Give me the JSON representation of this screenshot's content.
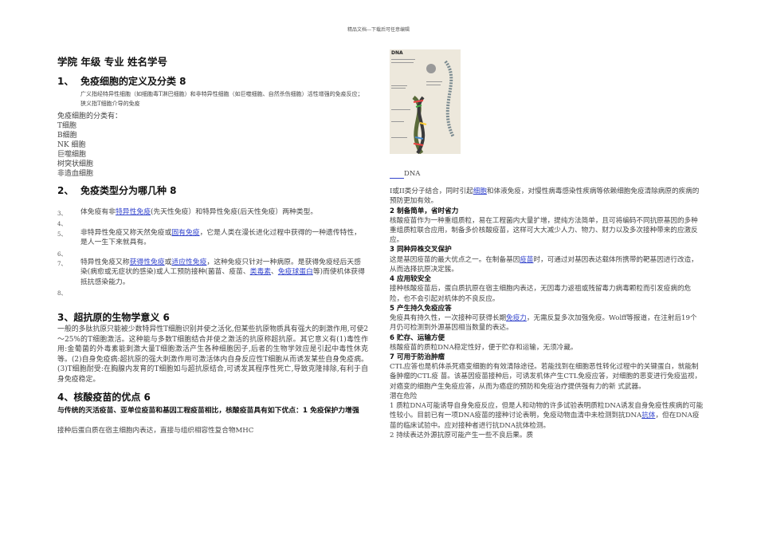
{
  "header": "精品文档---下载后可任意编辑",
  "title": "学院 年级 专业 姓名学号",
  "s1": {
    "num": "1、",
    "title": "免疫细胞的定义及分类 8",
    "def": "广义指经特异性细胞（如细胞毒T淋巴细胞）和非特异性细胞（如巨噬细胞、自然杀伤细胞）活性增强的免疫反应；狭义指T细胞介导的免疫",
    "cls_label": "免疫细胞的分类有：",
    "cells": [
      "T细胞",
      "B细胞",
      "NK 细胞",
      "巨噬细胞",
      "树突状细胞",
      "非造血细胞"
    ]
  },
  "s2": {
    "num": "2、",
    "title": "免疫类型分为哪几种 8",
    "items": [
      {
        "n": "3、",
        "a": "体免疫有非",
        "l1": "特异性免疫",
        "b": "(先天性免疫）和特异性免疫(后天性免疫）两种类型。"
      },
      {
        "n": "4、"
      },
      {
        "n": "5、",
        "a": "非特异性免疫又称天然免疫或",
        "l1": "固有免疫",
        "b": "，它是人类在漫长进化过程中获得的一种遗传特性，是人一生下来就具有。"
      },
      {
        "n": "6、"
      },
      {
        "n": "7、",
        "a": "特异性免疫又称",
        "l1": "获得性免疫",
        "m": "或",
        "l2": "适应性免疫",
        "b": "，这种免疫只针对一种病原。是获得免疫经后天感染(病愈或无症状的感染)或人工预防接种(菌苗、疫苗、",
        "l3": "类毒素",
        "c": "、",
        "l4": "免疫球蛋白",
        "d": "等)而使机体获得抵抗感染能力。"
      },
      {
        "n": "8、"
      }
    ]
  },
  "s3": {
    "title": "3、超抗原的生物学意义 6",
    "text": "一般的多肽抗原只能被少数特异性T细胞识别并使之活化,但某些抗原物质具有强大的刺激作用,可使2～25%的T细胞激活。这种能与多数T细胞结合并使之激活的抗原称超抗原。其它意义有(1)毒性作用:金葡菌的外毒素能刺激大量T细胞激活产生各种细胞因子,后者的生物学效应是引起中毒性休克等。(2)自身免疫病:超抗原的强大刺激作用可激活体内自身反应性T细胞从而诱发某些自身免疫病。(3)T细胞耐受:在胸腺内发育的T细胞如与超抗原结合,可诱发其程序性死亡,导致克隆排除,有利于自身免疫稳定。"
  },
  "s4": {
    "title": "4、核酸疫苗的优点 6",
    "intro": "与传统的灭活疫苗、亚单位疫苗和基因工程疫苗相比，核酸疫苗具有如下优点：1 免疫保护力增强",
    "p1": "接种后蛋白质在宿主细胞内表达，直接与组织相容性复合物MHC"
  },
  "right": {
    "img_label": "DNA",
    "caption": "DNA",
    "p1a": "I或II类分子结合，同时引起",
    "p1l": "细胞",
    "p1b": "和体液免疫，对慢性病毒感染性疾病等依赖细胞免疫清除病原的疾病的预防更加有效。",
    "h2": "2 制备简单，省时省力",
    "p2": "核酸疫苗作为一种重组质粒，易在工程菌内大量扩增，提纯方法简单，且可将编码不同抗原基因的多种重组质粒联合应用，制备多价核酸疫苗，这样可大大减少人力、物力、财力以及多次接种带来的应激反应。",
    "h3": "3 同种异株交叉保护",
    "p3a": "这是基因疫苗的最大优点之一。在制备基因",
    "p3l": "疫苗",
    "p3b": "时，可通过对基因表达载体所携带的靶基因进行改造，从而选择抗原决定簇。",
    "h4": "4 应用较安全",
    "p4": "接种核酸疫苗后，蛋白质抗原在宿主细胞内表达，无因毒力返祖或残留毒力病毒颗粒而引发疫病的危险，也不会引起对机体的不良反应。",
    "h5": "5 产生持久免疫应答",
    "p5a": "免疫具有持久性，一次接种可获得长期",
    "p5l": "免疫力",
    "p5b": "，无需反复多次加强免疫。Wolff等报道，在注射后19个月仍可检测到外源基因相当数量的表达。",
    "h6": "6 贮存、运输方便",
    "p6": "核酸疫苗的质粒DNA稳定性好，便于贮存和运输，无须冷藏。",
    "h7": "7 可用于防治肿瘤",
    "p7": "CTL应答也是机体杀死癌变细胞的有效清除途径。若能找到在细胞恶性转化过程中的关键蛋白，就能制备肿瘤的CTL疫 苗。该基因疫苗接种后，可诱发机体产生CTL免疫应答，对细胞的恶变进行免疫监视，对癌变的细胞产生免疫应答，从而为癌症的预防和免疫治疗提供强有力的新 式武器。",
    "risk": "潜在危险",
    "r1a": "1 质粒DNA可能诱导自身免疫反应，但是人和动物的许多试验表明质粒DNA诱发自身免疫性疾病的可能性较小。目前已有一项DNA疫苗的接种讨论表明，免疫动物血清中未检测到抗DNA",
    "r1l": "抗体",
    "r1b": "，但在DNA疫苗的临床试验中。应对接种者进行抗DNA抗体检测。",
    "r2": "2 持续表达外源抗原可能产生一些不良后果。质"
  },
  "colors": {
    "link": "#3344cc"
  }
}
